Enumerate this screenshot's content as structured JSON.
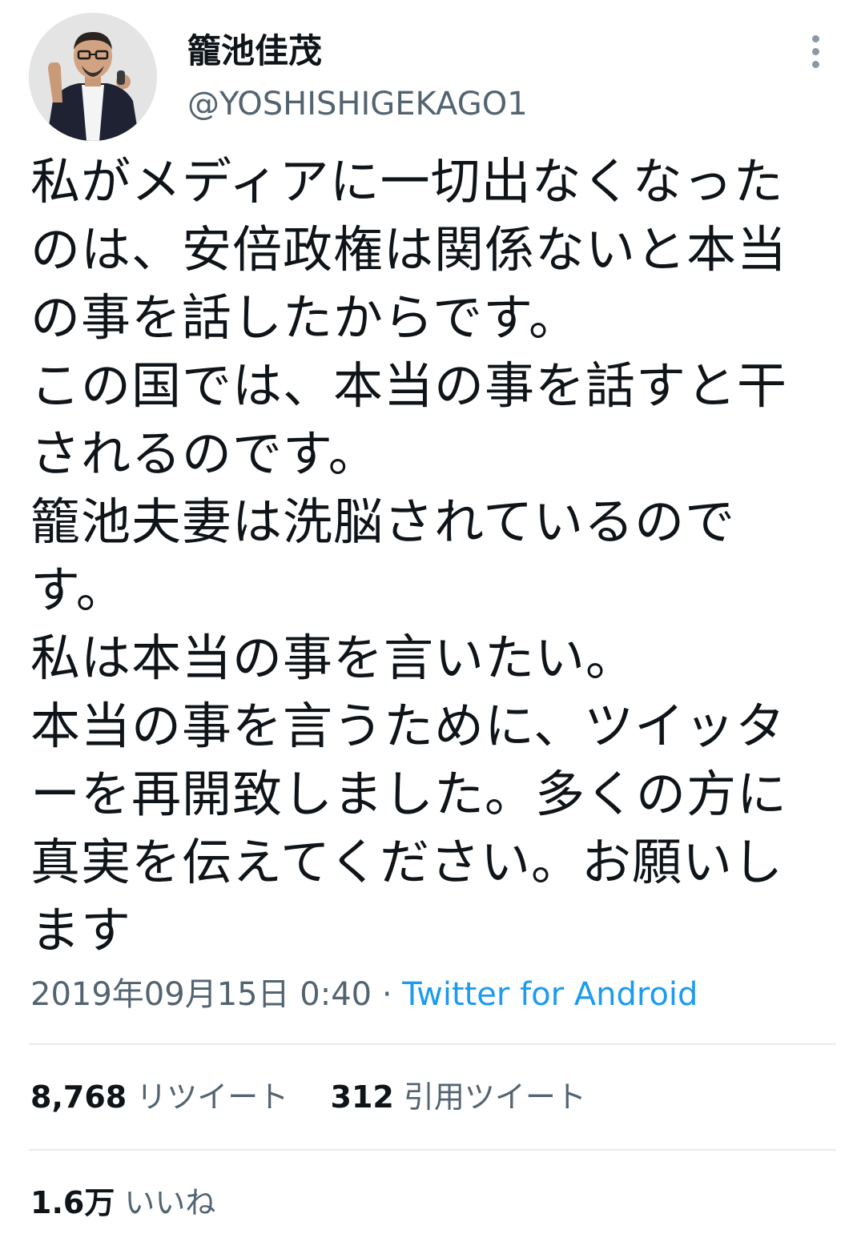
{
  "author": {
    "display_name": "籠池佳茂",
    "handle": "@YOSHISHIGEKAGO1"
  },
  "icons": {
    "more": "more-vertical-icon",
    "avatar": "profile-photo"
  },
  "tweet": {
    "lines": [
      "私がメディアに一切出なくなった",
      "のは、安倍政権は関係ないと本当",
      "の事を話したからです。",
      "この国では、本当の事を話すと干",
      "されるのです。",
      "籠池夫妻は洗脳されているので",
      "す。",
      "私は本当の事を言いたい。",
      "本当の事を言うために、ツイッタ",
      "ーを再開致しました。多くの方に",
      "真実を伝えてください。お願いし",
      "ます"
    ],
    "timestamp": "2019年09月15日 0:40",
    "separator": " · ",
    "source": "Twitter for Android"
  },
  "stats": {
    "retweets": {
      "count": "8,768",
      "label": "リツイート"
    },
    "quotes": {
      "count": "312",
      "label": "引用ツイート"
    },
    "likes": {
      "count": "1.6万",
      "label": "いいね"
    }
  },
  "colors": {
    "text": "#0f1419",
    "secondary": "#536471",
    "link": "#1d9bf0",
    "divider": "#e6ecf0"
  }
}
